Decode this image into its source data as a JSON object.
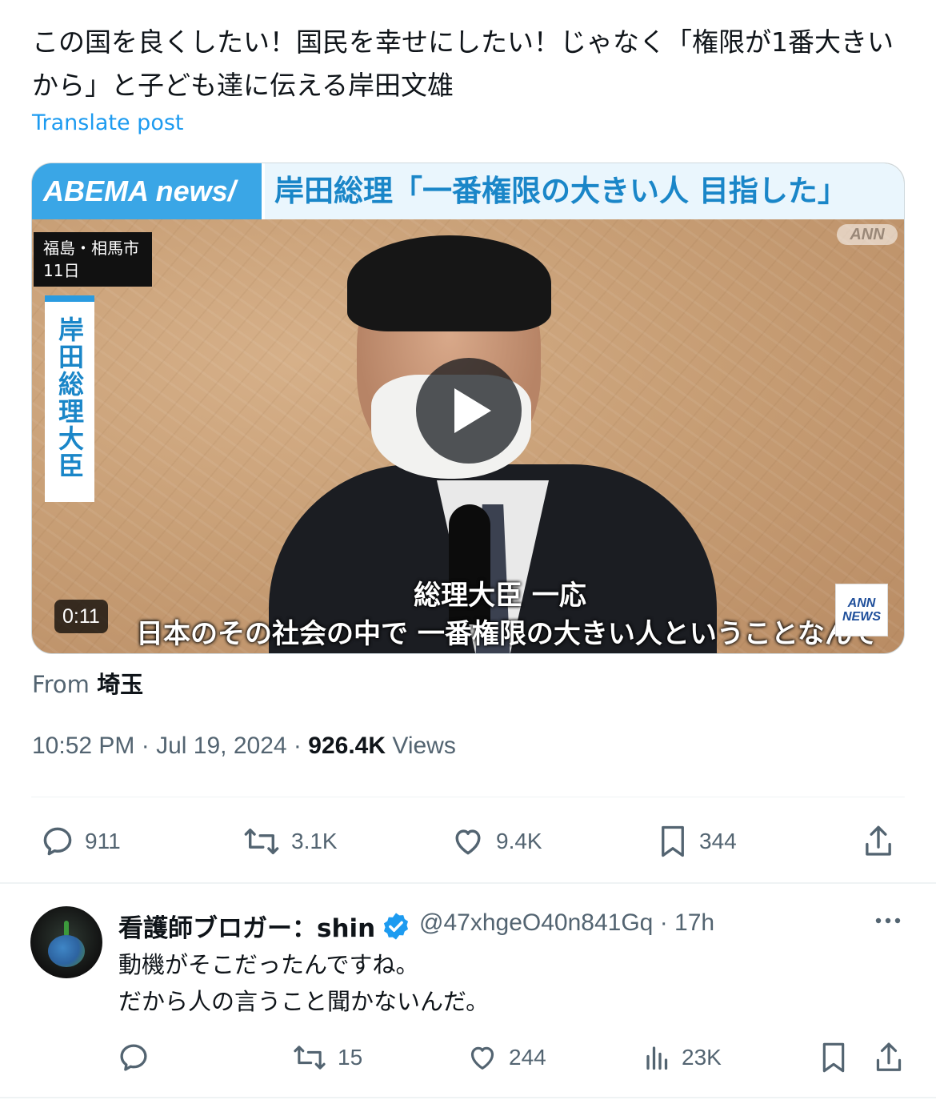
{
  "post": {
    "text": "この国を良くしたい！国民を幸せにしたい！じゃなく「権限が1番大きいから」と子ども達に伝える岸田文雄",
    "translate_label": "Translate post",
    "from_prefix": "From",
    "from_place": "埼玉",
    "time": "10:52 PM",
    "date": "Jul 19, 2024",
    "views_count": "926.4K",
    "views_label": "Views",
    "sep": "·"
  },
  "video": {
    "banner_logo": "ABEMA news/",
    "banner_title": "岸田総理「一番権限の大きい人 目指した」",
    "ann_top": "ANN",
    "location_line1": "福島・相馬市",
    "location_line2": "11日",
    "vertical_caption": "岸田総理大臣",
    "subtitle_line1": "総理大臣 一応",
    "subtitle_line2": "日本のその社会の中で 一番権限の大きい人ということなんで",
    "ann_badge_top": "ANN",
    "ann_badge_bottom": "NEWS",
    "duration": "0:11"
  },
  "actions": {
    "reply_count": "911",
    "repost_count": "3.1K",
    "like_count": "9.4K",
    "bookmark_count": "344"
  },
  "reply": {
    "name": "看護師ブロガー：shin",
    "handle": "@47xhgeO40n841Gq",
    "sep": "·",
    "time": "17h",
    "text_line1": "動機がそこだったんですね。",
    "text_line2": "だから人の言うこと聞かないんだ。",
    "repost_count": "15",
    "like_count": "244",
    "views_count": "23K"
  },
  "colors": {
    "accent": "#1d9bf0",
    "muted": "#536471",
    "text": "#0f1419"
  }
}
